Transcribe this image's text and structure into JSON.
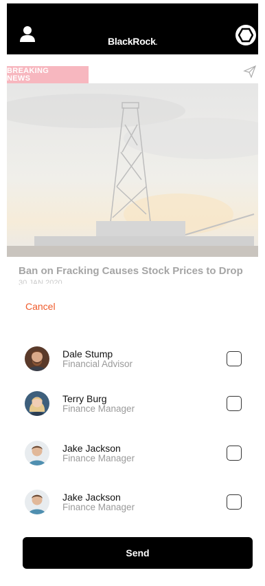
{
  "header": {
    "brand": "BlackRock",
    "brand_suffix": "."
  },
  "article": {
    "badge_line1": "BREAKING",
    "badge_line2": "NEWS",
    "title": "Ban on Fracking Causes Stock Prices to Drop",
    "date": "30 JAN 2020"
  },
  "sheet": {
    "cancel_label": "Cancel",
    "contacts": [
      {
        "name": "Dale Stump",
        "role": "Financial Advisor",
        "checked": false
      },
      {
        "name": "Terry Burg",
        "role": "Finance Manager",
        "checked": false
      },
      {
        "name": "Jake Jackson",
        "role": "Finance Manager",
        "checked": false
      },
      {
        "name": "Jake Jackson",
        "role": "Finance Manager",
        "checked": false
      }
    ],
    "send_label": "Send"
  },
  "colors": {
    "accent": "#ef5a2a",
    "badge": "#f7b7bf",
    "header_bg": "#000000"
  },
  "icons": [
    "user-icon",
    "hexagon-icon",
    "paper-plane-icon"
  ]
}
